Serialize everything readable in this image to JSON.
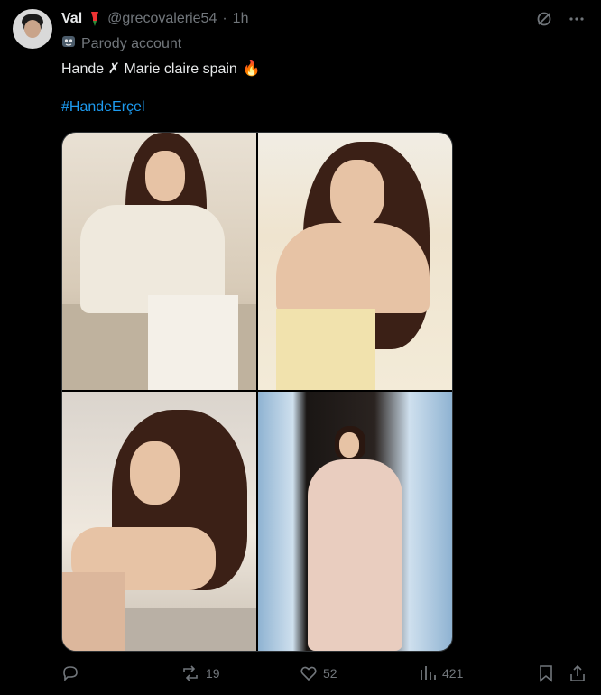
{
  "post": {
    "author_name": "Val",
    "handle": "@grecovalerie54",
    "separator": "·",
    "time": "1h",
    "parody_label": "Parody account",
    "text": "Hande ✗ Marie claire spain",
    "text_emoji": "🔥",
    "hashtag": "#HandeErçel"
  },
  "actions": {
    "reply_count": "",
    "repost_count": "19",
    "like_count": "52",
    "views_count": "421"
  },
  "icons": {
    "author_badge": "pin-icon",
    "parody": "mask-icon",
    "grok": "grok-icon",
    "more": "more-icon",
    "reply": "reply-icon",
    "repost": "repost-icon",
    "like": "heart-icon",
    "views": "views-icon",
    "bookmark": "bookmark-icon",
    "share": "share-icon"
  },
  "colors": {
    "background": "#000000",
    "text": "#e7e9ea",
    "muted": "#71767b",
    "accent": "#1d9bf0"
  }
}
